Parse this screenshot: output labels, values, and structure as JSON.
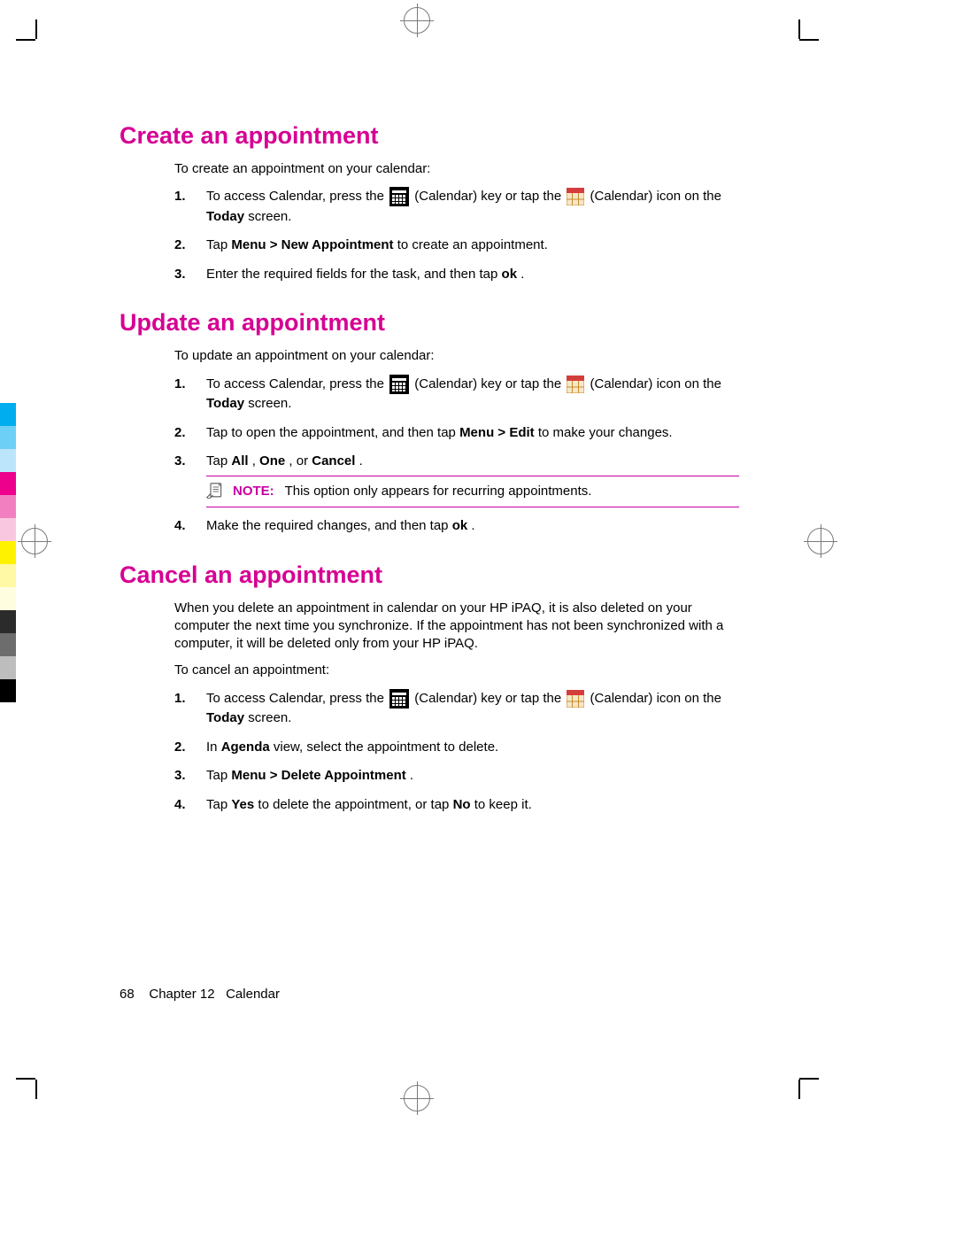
{
  "footer": {
    "page_number": "68",
    "chapter_label": "Chapter 12",
    "chapter_title": "Calendar"
  },
  "sections": {
    "create": {
      "heading": "Create an appointment",
      "intro": "To create an appointment on your calendar:",
      "step1_pre": "To access Calendar, press the ",
      "step1_mid": " (Calendar) key or tap the ",
      "step1_post": " (Calendar) icon on the ",
      "step1_today": "Today",
      "step1_screen": " screen.",
      "step2_pre": "Tap ",
      "step2_bold": "Menu > New Appointment",
      "step2_post": " to create an appointment.",
      "step3_pre": "Enter the required fields for the task, and then tap ",
      "step3_bold": "ok",
      "step3_post": "."
    },
    "update": {
      "heading": "Update an appointment",
      "intro": "To update an appointment on your calendar:",
      "step1_pre": "To access Calendar, press the ",
      "step1_mid": " (Calendar) key or tap the ",
      "step1_post": " (Calendar) icon on the ",
      "step1_today": "Today",
      "step1_screen": " screen.",
      "step2_pre": "Tap to open the appointment, and then tap ",
      "step2_bold": "Menu > Edit",
      "step2_post": " to make your changes.",
      "step3_pre": "Tap ",
      "step3_b1": "All",
      "step3_sep1": ", ",
      "step3_b2": "One",
      "step3_sep2": ", or ",
      "step3_b3": "Cancel",
      "step3_post": ".",
      "note_label": "NOTE:",
      "note_text": "This option only appears for recurring appointments.",
      "step4_pre": "Make the required changes, and then tap ",
      "step4_bold": "ok",
      "step4_post": "."
    },
    "cancel": {
      "heading": "Cancel an appointment",
      "intro_long": "When you delete an appointment in calendar on your HP iPAQ, it is also deleted on your computer the next time you synchronize. If the appointment has not been synchronized with a computer, it will be deleted only from your HP iPAQ.",
      "intro_short": "To cancel an appointment:",
      "step1_pre": "To access Calendar, press the ",
      "step1_mid": " (Calendar) key or tap the ",
      "step1_post": " (Calendar) icon on the ",
      "step1_today": "Today",
      "step1_screen": " screen.",
      "step2_pre": "In ",
      "step2_bold": "Agenda",
      "step2_post": " view, select the appointment to delete.",
      "step3_pre": "Tap ",
      "step3_bold": "Menu > Delete Appointment",
      "step3_post": ".",
      "step4_pre": "Tap ",
      "step4_b1": "Yes",
      "step4_mid": " to delete the appointment, or tap ",
      "step4_b2": "No",
      "step4_post": " to keep it."
    }
  }
}
